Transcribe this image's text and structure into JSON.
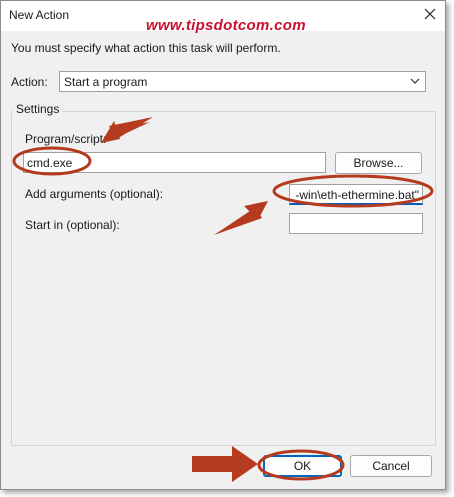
{
  "dialog": {
    "title": "New Action",
    "instruction": "You must specify what action this task will perform."
  },
  "watermark": "www.tipsdotcom.com",
  "action": {
    "label": "Action:",
    "selected": "Start a program"
  },
  "settings": {
    "group_label": "Settings",
    "program_label": "Program/script:",
    "program_value": "cmd.exe",
    "browse_label": "Browse...",
    "arguments_label": "Add arguments (optional):",
    "arguments_value": "-win\\eth-ethermine.bat\"",
    "start_in_label": "Start in (optional):",
    "start_in_value": ""
  },
  "buttons": {
    "ok": "OK",
    "cancel": "Cancel"
  },
  "colors": {
    "annotation": "#b53a1e",
    "watermark": "#c8102e",
    "focus": "#0067c0"
  },
  "icons": [
    "close-icon",
    "chevron-down-icon",
    "arrow-icon"
  ]
}
